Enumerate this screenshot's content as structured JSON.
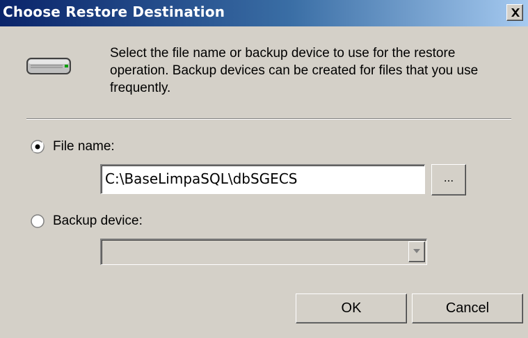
{
  "window": {
    "title": "Choose Restore Destination",
    "close_glyph": "×"
  },
  "intro": {
    "icon": "backup-device-icon",
    "text": "Select the file name or backup device to use for the restore operation.  Backup devices can be created for files that you use frequently."
  },
  "file_name": {
    "label": "File name:",
    "selected": true,
    "value": "C:\\BaseLimpaSQL\\dbSGECS",
    "browse_label": "..."
  },
  "backup_device": {
    "label": "Backup device:",
    "selected": false,
    "value": "",
    "enabled": false
  },
  "buttons": {
    "ok": "OK",
    "cancel": "Cancel"
  },
  "colors": {
    "dialog_face": "#d4d0c8",
    "title_gradient_start": "#0a246a",
    "title_gradient_end": "#a6caf0"
  }
}
